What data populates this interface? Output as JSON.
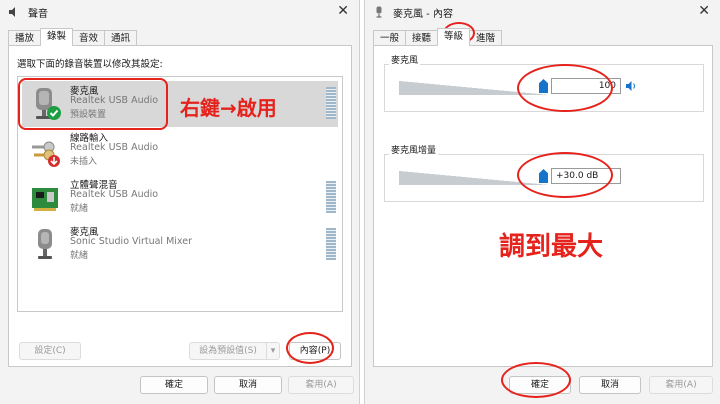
{
  "left": {
    "title": "聲音",
    "tabs": [
      "播放",
      "錄製",
      "音效",
      "通訊"
    ],
    "instruction": "選取下面的錄音裝置以修改其設定:",
    "devices": [
      {
        "name": "麥克風",
        "driver": "Realtek USB Audio",
        "status": "預設裝置"
      },
      {
        "name": "線路輸入",
        "driver": "Realtek USB Audio",
        "status": "未插入"
      },
      {
        "name": "立體聲混音",
        "driver": "Realtek USB Audio",
        "status": "就緒"
      },
      {
        "name": "麥克風",
        "driver": "Sonic Studio Virtual Mixer",
        "status": "就緒"
      }
    ],
    "buttons": {
      "configure": "設定(C)",
      "set_default": "設為預設值(S)",
      "properties": "內容(P)",
      "ok": "確定",
      "cancel": "取消",
      "apply": "套用(A)"
    }
  },
  "right": {
    "title": "麥克風 - 內容",
    "tabs": [
      "一般",
      "接聽",
      "等級",
      "進階"
    ],
    "mic_label": "麥克風",
    "mic_value": "100",
    "boost_label": "麥克風增量",
    "boost_value": "+30.0 dB",
    "buttons": {
      "ok": "確定",
      "cancel": "取消",
      "apply": "套用(A)"
    }
  },
  "annotations": {
    "right_click_enable": "右鍵→啟用",
    "max_it": "調到最大"
  },
  "colors": {
    "annotation": "#e5231c",
    "accent": "#1573c9"
  }
}
